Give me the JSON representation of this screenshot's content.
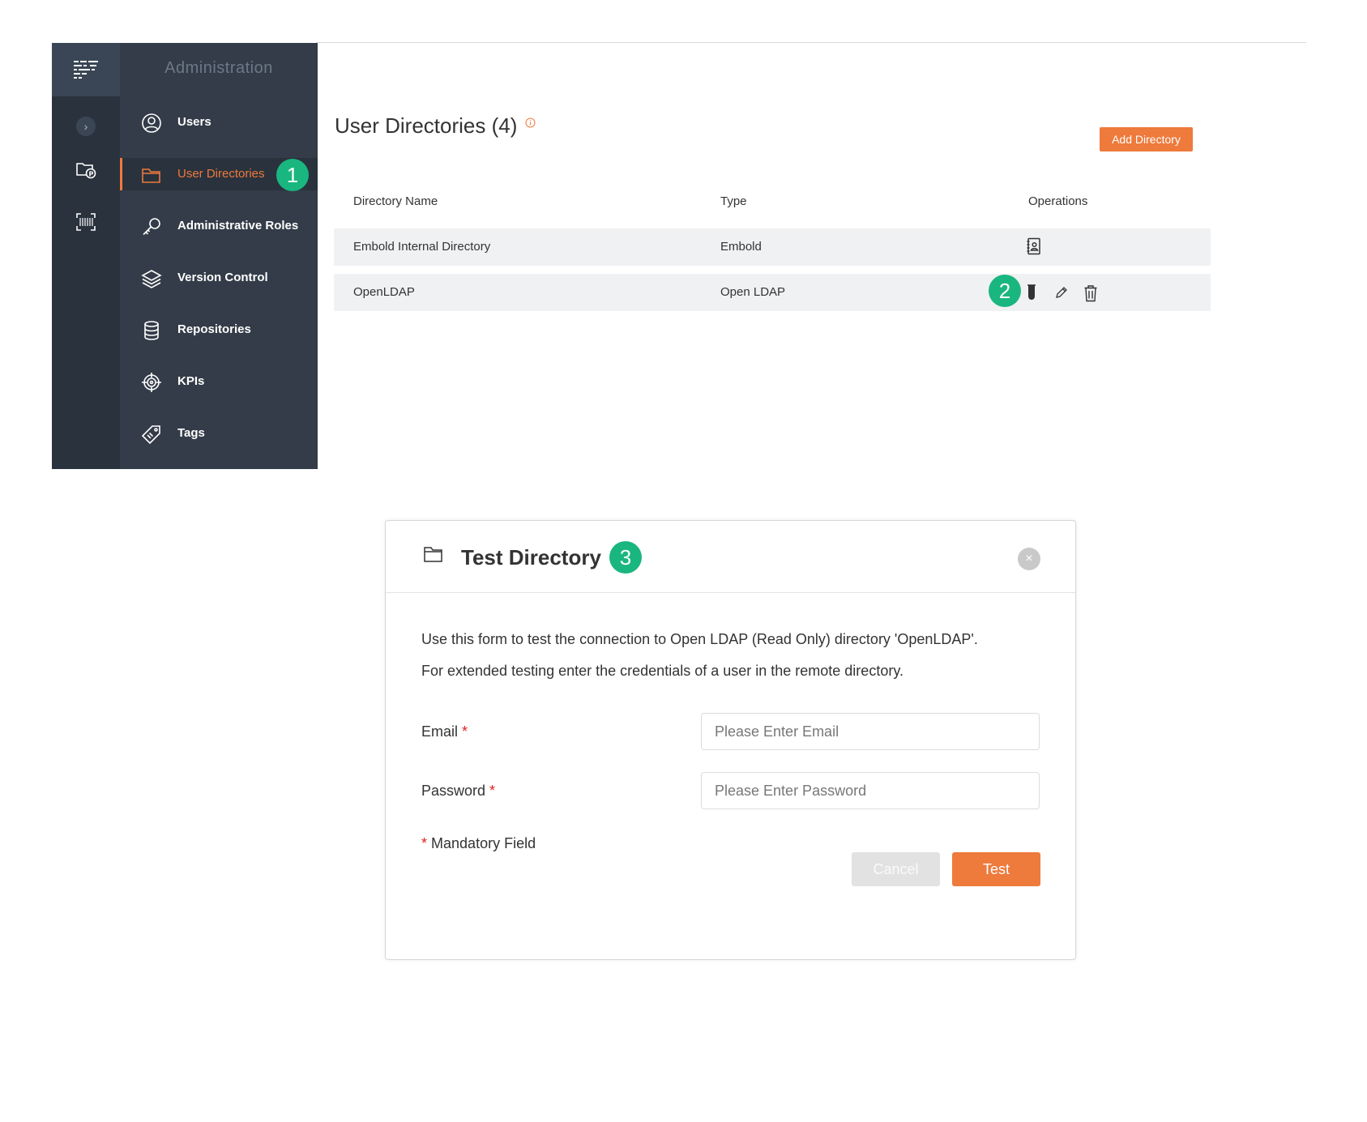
{
  "colors": {
    "accent": "#ee7a3c",
    "badge": "#1ab67f",
    "sidebar_dark": "#2a323d",
    "sidebar": "#333c48"
  },
  "sidebar": {
    "title": "Administration",
    "items": [
      {
        "label": "Users",
        "icon": "user-circle-icon"
      },
      {
        "label": "User Directories",
        "icon": "folder-icon",
        "active": true
      },
      {
        "label": "Administrative Roles",
        "icon": "key-icon"
      },
      {
        "label": "Version Control",
        "icon": "layers-icon"
      },
      {
        "label": "Repositories",
        "icon": "database-icon"
      },
      {
        "label": "KPIs",
        "icon": "target-icon"
      },
      {
        "label": "Tags",
        "icon": "tags-icon"
      }
    ]
  },
  "rail": {
    "toggle": "›",
    "icons": [
      "logo-icon",
      "projects-icon",
      "scan-icon"
    ]
  },
  "badges": {
    "one": "1",
    "two": "2",
    "three": "3"
  },
  "main": {
    "title": "User Directories (4)",
    "add_button": "Add Directory",
    "columns": [
      "Directory Name",
      "Type",
      "Operations"
    ],
    "rows": [
      {
        "name": "Embold Internal Directory",
        "type": "Embold",
        "operations": [
          "address-book-icon"
        ]
      },
      {
        "name": "OpenLDAP",
        "type": "Open LDAP",
        "operations": [
          "test-tube-icon",
          "edit-pencil-icon",
          "trash-icon"
        ]
      }
    ]
  },
  "dialog": {
    "title": "Test Directory",
    "close": "×",
    "line1": "Use this form to test the connection to Open LDAP (Read Only) directory 'OpenLDAP'.",
    "line2": "For extended testing enter the credentials of a user in the remote directory.",
    "email_label": "Email",
    "email_placeholder": "Please Enter Email",
    "password_label": "Password",
    "password_placeholder": "Please Enter Password",
    "required_mark": "*",
    "mandatory_note": "Mandatory Field",
    "cancel_label": "Cancel",
    "test_label": "Test"
  }
}
